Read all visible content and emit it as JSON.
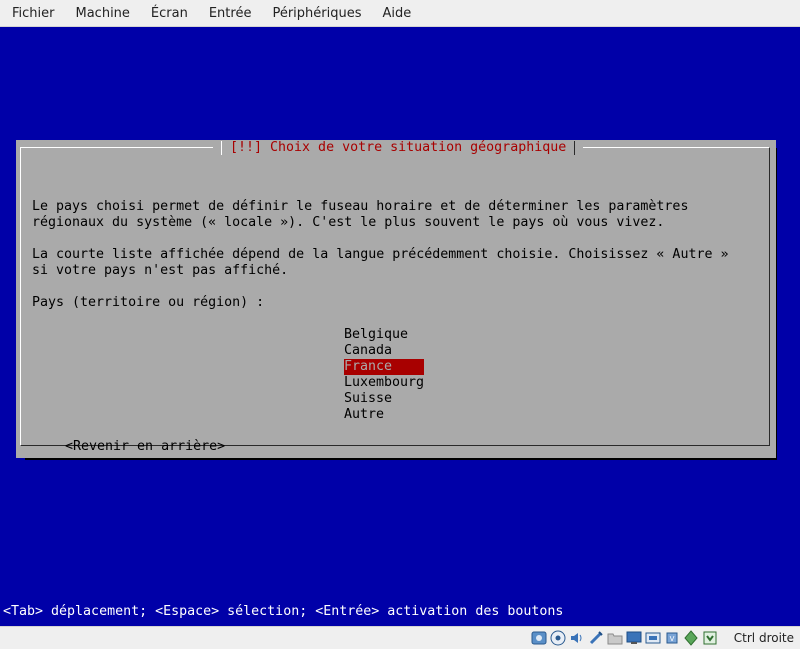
{
  "menubar": {
    "items": [
      "Fichier",
      "Machine",
      "Écran",
      "Entrée",
      "Périphériques",
      "Aide"
    ]
  },
  "dialog": {
    "title": "[!!] Choix de votre situation géographique",
    "paragraph1": "Le pays choisi permet de définir le fuseau horaire et de déterminer les paramètres\nrégionaux du système (« locale »). C'est le plus souvent le pays où vous vivez.",
    "paragraph2": "La courte liste affichée dépend de la langue précédemment choisie. Choisissez « Autre »\nsi votre pays n'est pas affiché.",
    "prompt": "Pays (territoire ou région) :",
    "countries": [
      "Belgique",
      "Canada",
      "France",
      "Luxembourg",
      "Suisse",
      "Autre"
    ],
    "selected_country": "France",
    "back_button": "<Revenir en arrière>"
  },
  "help_line": "<Tab> déplacement; <Espace> sélection; <Entrée> activation des boutons",
  "host_status": {
    "host_key": "Ctrl droite",
    "indicator_icons": [
      "optical-drive-icon",
      "cd-icon",
      "audio-icon",
      "usb-icon",
      "shared-folder-icon",
      "display-icon",
      "video-capture-icon",
      "cpu-icon",
      "network-icon",
      "mouse-integration-icon"
    ]
  },
  "colors": {
    "screen_background": "#0000a8",
    "dialog_background": "#aaaaaa",
    "title_text": "#a80000",
    "selection_background": "#a80000"
  }
}
